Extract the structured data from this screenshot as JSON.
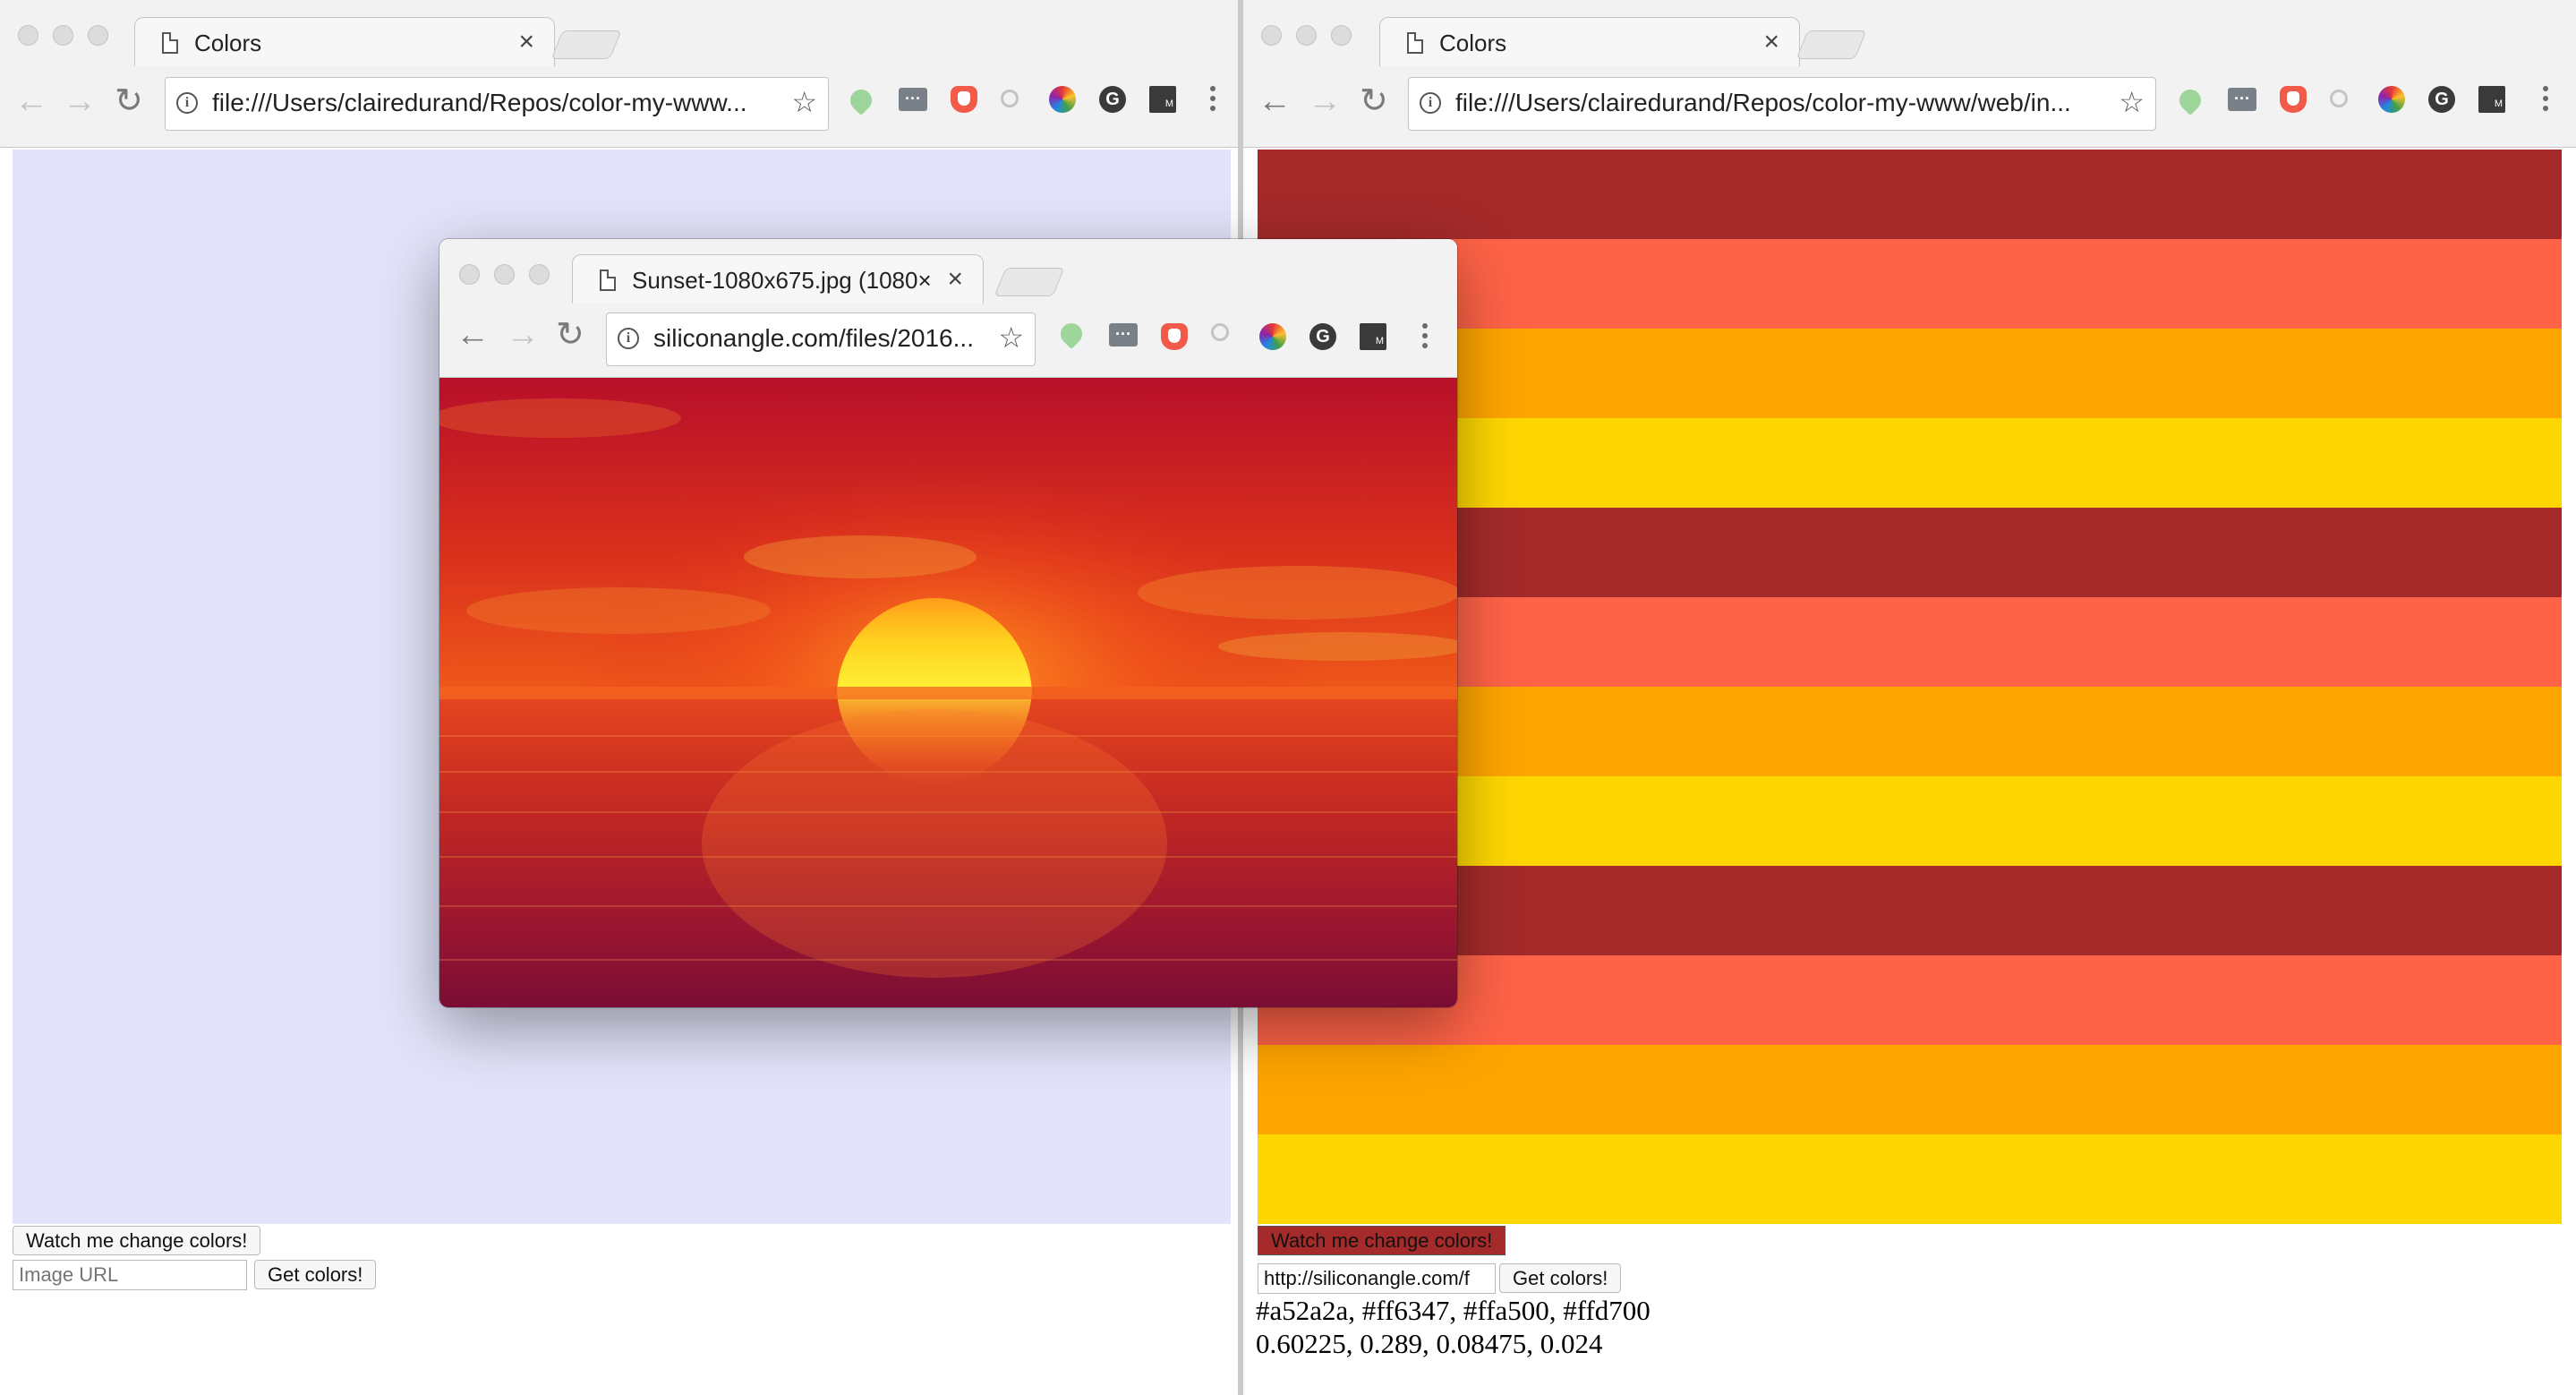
{
  "left_window": {
    "tab_title": "Colors",
    "url": "file:///Users/clairedurand/Repos/color-my-www...",
    "canvas_color": "#e3e4fa",
    "watch_button": "Watch me change colors!",
    "image_url_placeholder": "Image URL",
    "get_colors_button": "Get colors!"
  },
  "right_window": {
    "tab_title": "Colors",
    "url": "file:///Users/clairedurand/Repos/color-my-www/web/in...",
    "stripe_colors": [
      "#a52a2a",
      "#ff6347",
      "#ffa500",
      "#ffd700",
      "#a52a2a",
      "#ff6347",
      "#ffa500",
      "#ffd700",
      "#a52a2a",
      "#ff6347",
      "#ffa500",
      "#ffd700"
    ],
    "watch_button": "Watch me change colors!",
    "watch_button_bg": "#a52a2a",
    "image_url_value": "http://siliconangle.com/f",
    "get_colors_button": "Get colors!",
    "colors_output": "#a52a2a, #ff6347, #ffa500, #ffd700",
    "proportions_output": "0.60225, 0.289, 0.08475, 0.024"
  },
  "popup_window": {
    "tab_title": "Sunset-1080x675.jpg (1080×",
    "url": "siliconangle.com/files/2016...",
    "image_description": "sunset-image"
  },
  "icons": {
    "close": "×",
    "star": "☆",
    "back": "←",
    "forward": "→",
    "reload": "↻",
    "info": "i"
  }
}
